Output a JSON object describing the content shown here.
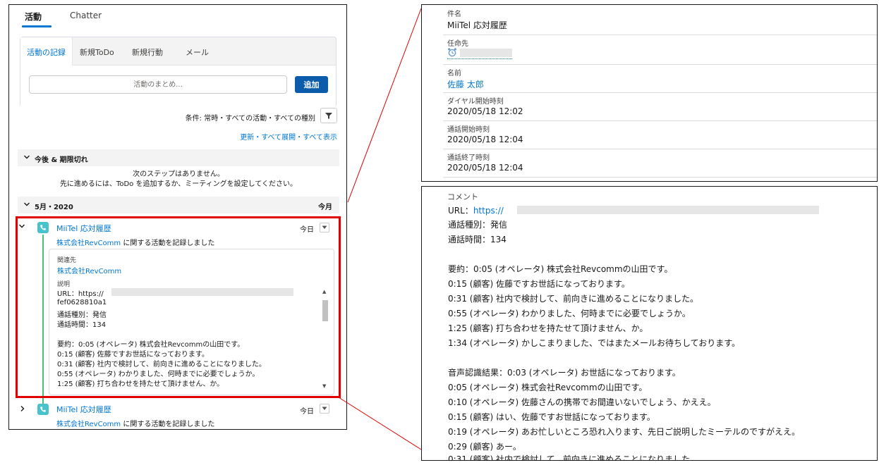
{
  "left": {
    "tabs": [
      "活動",
      "Chatter"
    ],
    "composer": {
      "tabs": [
        "活動の記録",
        "新規ToDo",
        "新規行動",
        "メール"
      ],
      "input_placeholder": "活動のまとめ...",
      "add_label": "追加"
    },
    "filter_text": "条件: 常時・すべての活動・すべての種別",
    "links": [
      "更新",
      "すべて展開",
      "すべて表示"
    ],
    "link_separator": "・",
    "upcoming": {
      "label": "今後 & 期限切れ",
      "empty_line1": "次のステップはありません。",
      "empty_line2": "先に進めるには、ToDo を追加するか、ミーティングを設定してください。"
    },
    "month": {
      "label": "5月・2020",
      "right": "今月"
    },
    "items": [
      {
        "title": "MiiTel 応対履歴",
        "account": "株式会社RevComm",
        "subtitle_suffix": " に関する活動を記録しました",
        "date": "今日"
      },
      {
        "title": "MiiTel 応対履歴",
        "account": "株式会社RevComm",
        "subtitle_suffix": " に関する活動を記録しました",
        "date": "今日"
      }
    ],
    "detail": {
      "related_label": "関連先",
      "related_value": "株式会社RevComm",
      "desc_label": "説明",
      "lines": [
        "URL：https://",
        "fef0628810a1",
        "通話種別：発信",
        "通話時間：134",
        "",
        "要約：0:05 (オペレータ) 株式会社Revcommの山田です。",
        "0:15 (顧客) 佐藤ですお世話になっております。",
        "0:31 (顧客) 社内で検討して、前向きに進めることになりました。",
        "0:55 (オペレータ) わかりました、何時までに必要でしょうか。",
        "1:25 (顧客) 打ち合わせを持たせて頂けません、か。"
      ]
    }
  },
  "right_top": {
    "fields": [
      {
        "label": "件名",
        "value": "MiiTel 応対履歴"
      },
      {
        "label": "任命先",
        "value": ""
      },
      {
        "label": "名前",
        "value": "佐藤 太郎"
      },
      {
        "label": "ダイヤル開始時刻",
        "value": "2020/05/18 12:02"
      },
      {
        "label": "通話開始時刻",
        "value": "2020/05/18 12:04"
      },
      {
        "label": "通話終了時刻",
        "value": "2020/05/18 12:04"
      }
    ]
  },
  "right_bottom": {
    "label": "コメント",
    "url_prefix": "URL：",
    "url_link": "https://",
    "lines": [
      "通話種別：発信",
      "通話時間：134",
      "",
      "要約：0:05 (オペレータ) 株式会社Revcommの山田です。",
      "0:15 (顧客) 佐藤ですお世話になっております。",
      "0:31 (顧客) 社内で検討して、前向きに進めることになりました。",
      "0:55 (オペレータ) わかりました、何時までに必要でしょうか。",
      "1:25 (顧客) 打ち合わせを持たせて頂けません、か。",
      "1:34 (オペレータ) かしこまりました、ではまたメールお待ちしております。",
      "",
      "音声認識結果：0:03 (オペレータ) お世話になっております。",
      "0:05 (オペレータ) 株式会社Revcommの山田です。",
      "0:10 (オペレータ) 佐藤さんの携帯でお間違いないでしょう、かええ。",
      "0:15 (顧客) はい、佐藤ですお世話になっております。",
      "0:19 (オペレータ) あお忙しいところ恐れ入ります、先日ご説明したミーテルのですがええ。",
      "0:29 (顧客) あー。",
      "0:31 (顧客) 社内で検討して、前向きに進めることになりました。"
    ]
  },
  "colors": {
    "link": "#0176d3",
    "brand_button": "#0b5cab",
    "call_icon": "#48c3cc",
    "timeline": "#4bc076",
    "highlight": "#e00000"
  }
}
